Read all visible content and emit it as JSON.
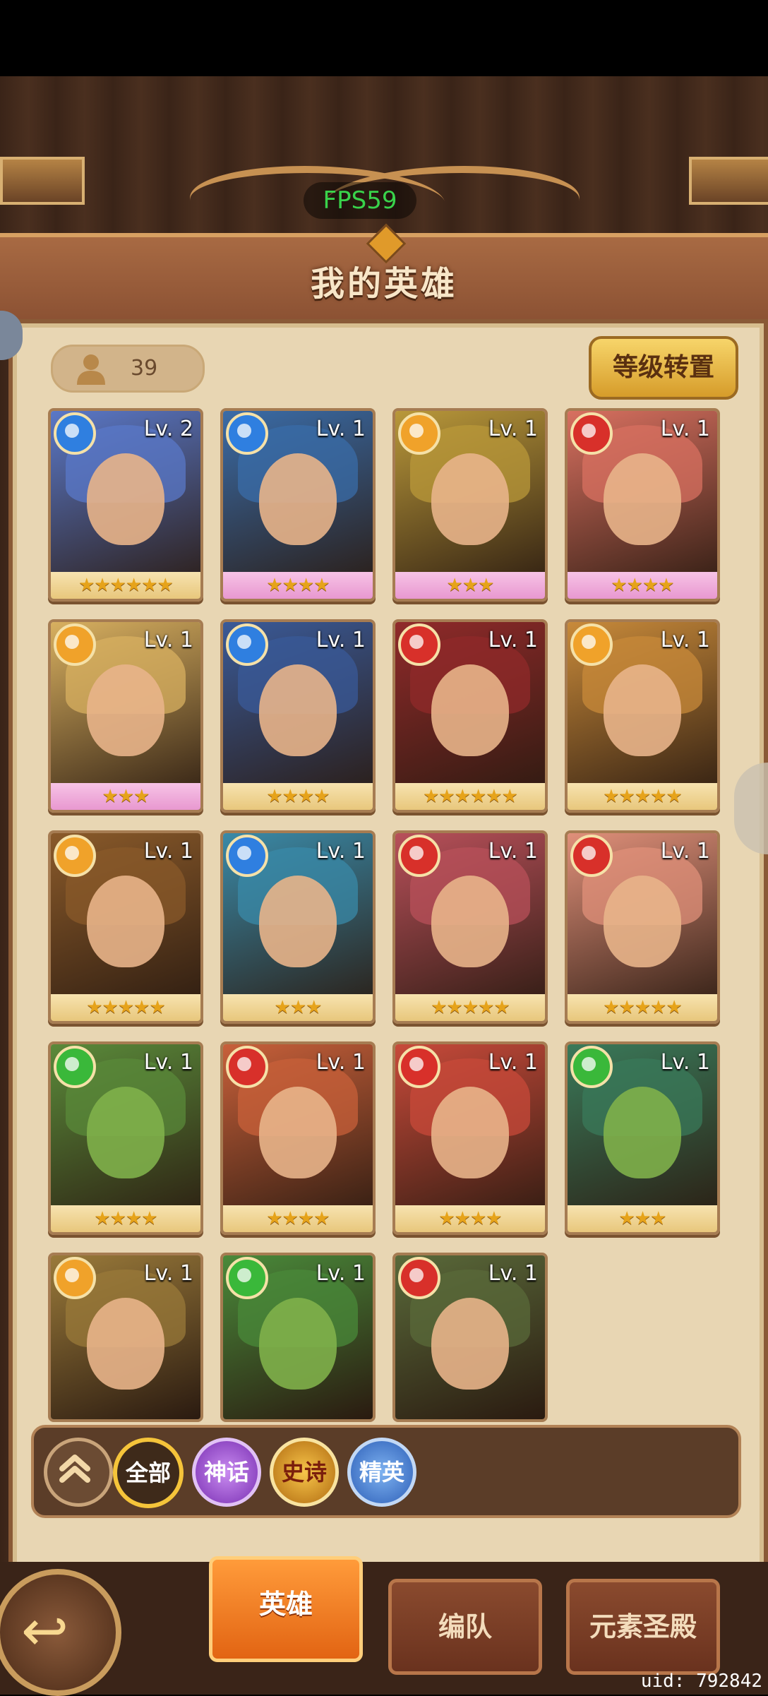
{
  "fps": "FPS59",
  "title": "我的英雄",
  "hero_count": "39",
  "level_reset_label": "等级转置",
  "heroes": [
    {
      "level": "Lv. 2",
      "element": "water",
      "stars": "★★★★★★",
      "rarity": "gold",
      "badge_color": "#2f7fe0",
      "portrait_color": "#5a78c8"
    },
    {
      "level": "Lv. 1",
      "element": "water",
      "stars": "★★★★",
      "rarity": "pink",
      "badge_color": "#2f7fe0",
      "portrait_color": "#3a6ca8"
    },
    {
      "level": "Lv. 1",
      "element": "light",
      "stars": "★★★",
      "rarity": "pink",
      "badge_color": "#f0a22a",
      "portrait_color": "#b9983a"
    },
    {
      "level": "Lv. 1",
      "element": "fire",
      "stars": "★★★★",
      "rarity": "pink",
      "badge_color": "#d8302a",
      "portrait_color": "#d87060"
    },
    {
      "level": "Lv. 1",
      "element": "light",
      "stars": "★★★",
      "rarity": "pink",
      "badge_color": "#f0a22a",
      "portrait_color": "#d8b060"
    },
    {
      "level": "Lv. 1",
      "element": "water",
      "stars": "★★★★",
      "rarity": "gold",
      "badge_color": "#2f7fe0",
      "portrait_color": "#3a5a98"
    },
    {
      "level": "Lv. 1",
      "element": "fire",
      "stars": "★★★★★★",
      "rarity": "gold",
      "badge_color": "#d8302a",
      "portrait_color": "#902a2a"
    },
    {
      "level": "Lv. 1",
      "element": "light",
      "stars": "★★★★★",
      "rarity": "gold",
      "badge_color": "#f0a22a",
      "portrait_color": "#c88a3a"
    },
    {
      "level": "Lv. 1",
      "element": "light",
      "stars": "★★★★★",
      "rarity": "gold",
      "badge_color": "#f0a22a",
      "portrait_color": "#8a5a2a"
    },
    {
      "level": "Lv. 1",
      "element": "water",
      "stars": "★★★",
      "rarity": "gold",
      "badge_color": "#2f7fe0",
      "portrait_color": "#3a8aa8"
    },
    {
      "level": "Lv. 1",
      "element": "fire",
      "stars": "★★★★★",
      "rarity": "gold",
      "badge_color": "#d8302a",
      "portrait_color": "#b8505a"
    },
    {
      "level": "Lv. 1",
      "element": "fire",
      "stars": "★★★★★",
      "rarity": "gold",
      "badge_color": "#d8302a",
      "portrait_color": "#e0907a"
    },
    {
      "level": "Lv. 1",
      "element": "wind",
      "stars": "★★★★",
      "rarity": "gold",
      "badge_color": "#3ab83a",
      "portrait_color": "#5a8a3a"
    },
    {
      "level": "Lv. 1",
      "element": "fire",
      "stars": "★★★★",
      "rarity": "gold",
      "badge_color": "#d8302a",
      "portrait_color": "#c8603a"
    },
    {
      "level": "Lv. 1",
      "element": "fire",
      "stars": "★★★★",
      "rarity": "gold",
      "badge_color": "#d8302a",
      "portrait_color": "#c84a3a"
    },
    {
      "level": "Lv. 1",
      "element": "wind",
      "stars": "★★★",
      "rarity": "gold",
      "badge_color": "#3ab83a",
      "portrait_color": "#3a7a5a"
    },
    {
      "level": "Lv. 1",
      "element": "light",
      "stars": "",
      "rarity": "gold",
      "badge_color": "#f0a22a",
      "portrait_color": "#9a7a3a"
    },
    {
      "level": "Lv. 1",
      "element": "wind",
      "stars": "",
      "rarity": "gold",
      "badge_color": "#3ab83a",
      "portrait_color": "#4a8a3a"
    },
    {
      "level": "Lv. 1",
      "element": "fire",
      "stars": "",
      "rarity": "gold",
      "badge_color": "#d8302a",
      "portrait_color": "#5a6a3a"
    }
  ],
  "filters": {
    "all": "全部",
    "myth": "神话",
    "epic": "史诗",
    "elite": "精英"
  },
  "tabs": {
    "heroes": "英雄",
    "team": "编队",
    "temple": "元素圣殿"
  },
  "uid": "uid: 792842"
}
